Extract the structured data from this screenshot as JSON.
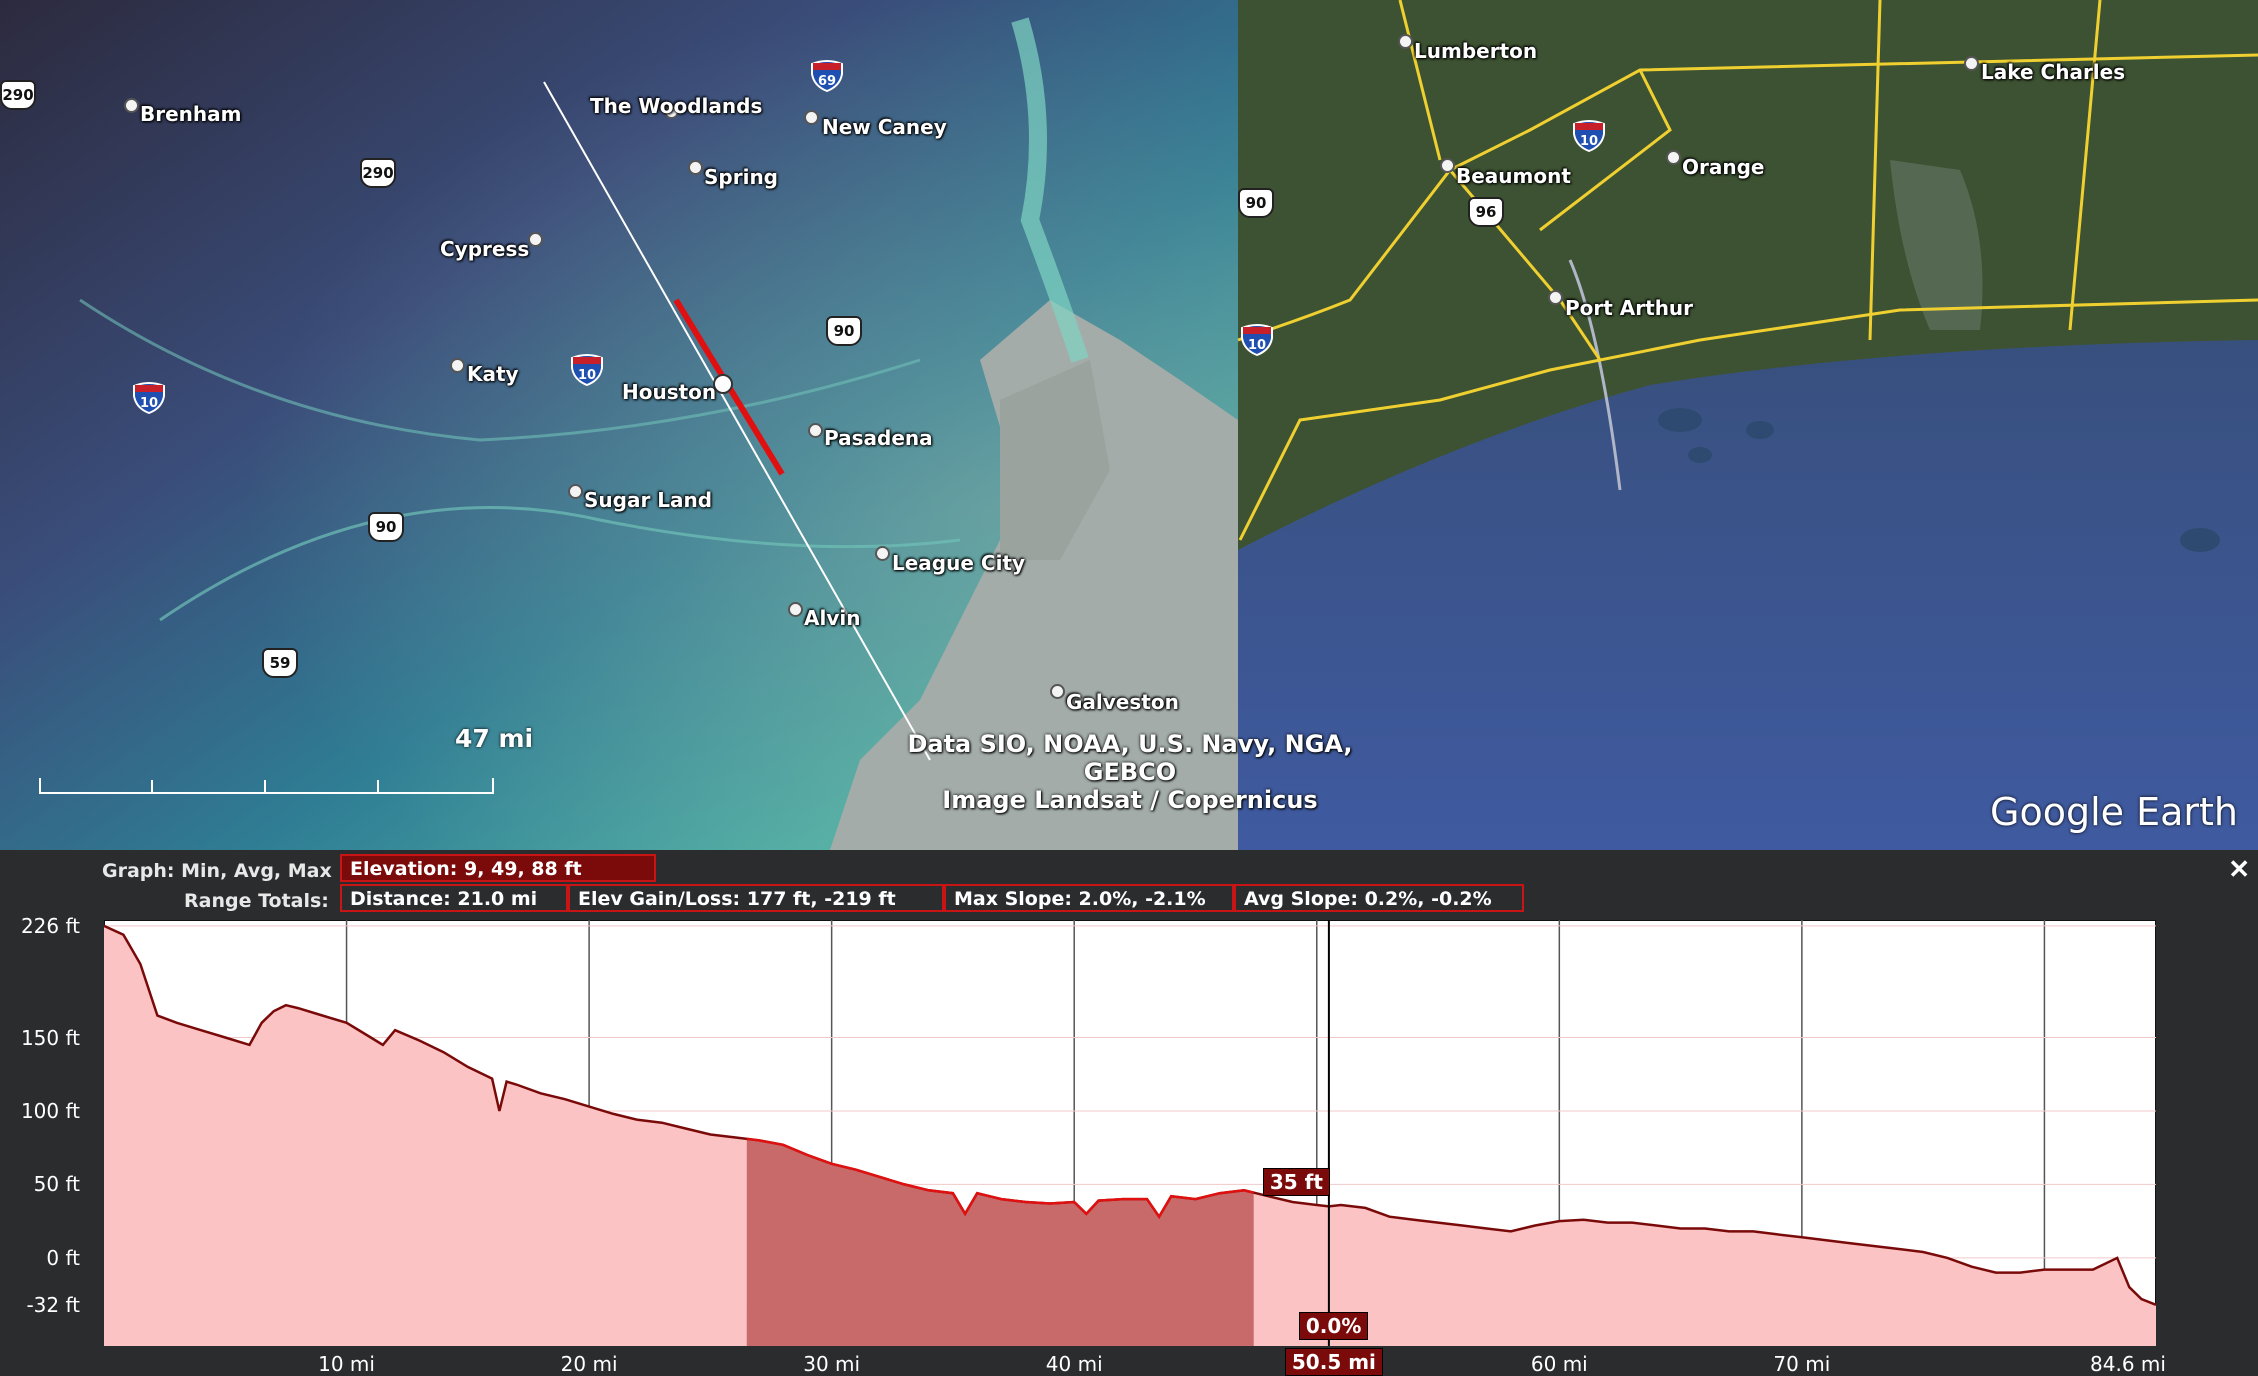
{
  "map": {
    "places": [
      {
        "name": "Brenham"
      },
      {
        "name": "The Woodlands"
      },
      {
        "name": "New Caney"
      },
      {
        "name": "Spring"
      },
      {
        "name": "Cypress"
      },
      {
        "name": "Katy"
      },
      {
        "name": "Houston"
      },
      {
        "name": "Pasadena"
      },
      {
        "name": "Sugar Land"
      },
      {
        "name": "League City"
      },
      {
        "name": "Alvin"
      },
      {
        "name": "Galveston"
      },
      {
        "name": "Lumberton"
      },
      {
        "name": "Beaumont"
      },
      {
        "name": "Orange"
      },
      {
        "name": "Port Arthur"
      },
      {
        "name": "Lake Charles"
      }
    ],
    "interstate_shields": [
      "69",
      "10",
      "10",
      "10",
      "10"
    ],
    "us_shields": [
      "290",
      "290",
      "90",
      "90",
      "59",
      "90",
      "96"
    ],
    "scale_label": "47 mi",
    "attribution_line1": "Data SIO, NOAA, U.S. Navy, NGA, GEBCO",
    "attribution_line2": "Image Landsat / Copernicus",
    "logo": "Google Earth",
    "colors": {
      "path_line": "#ffffff",
      "path_selected": "#e01010"
    }
  },
  "panel": {
    "graph_label": "Graph: Min, Avg, Max",
    "elevation": "Elevation: 9, 49, 88 ft",
    "range_label": "Range Totals:",
    "distance": "Distance: 21.0 mi",
    "elev_gain_loss": "Elev Gain/Loss: 177 ft, -219 ft",
    "max_slope": "Max Slope: 2.0%, -2.1%",
    "avg_slope": "Avg Slope: 0.2%, -0.2%",
    "close_label": "✕",
    "cursor_elev": "35 ft",
    "cursor_slope": "0.0%",
    "cursor_dist": "50.5 mi"
  },
  "chart_data": {
    "type": "area",
    "xlabel": "",
    "ylabel": "",
    "ylim": [
      -60,
      230
    ],
    "xlim": [
      0,
      84.6
    ],
    "y_ticks": [
      "226 ft",
      "150 ft",
      "100 ft",
      "50 ft",
      "0 ft",
      "-32 ft"
    ],
    "x_ticks": [
      "10 mi",
      "20 mi",
      "30 mi",
      "40 mi",
      "60 mi",
      "70 mi",
      "84.6 mi"
    ],
    "selection_range_mi": [
      26.5,
      47.4
    ],
    "cursor_mi": 50.5,
    "x": [
      0,
      0.8,
      1.5,
      2.2,
      3,
      4,
      5,
      6,
      6.5,
      7,
      7.5,
      8,
      9,
      10,
      11,
      11.5,
      12,
      13,
      14,
      15,
      16,
      16.3,
      16.6,
      17,
      18,
      19,
      20,
      21,
      22,
      23,
      24,
      25,
      26,
      27,
      28,
      29,
      30,
      31,
      32,
      33,
      34,
      35,
      35.5,
      36,
      36.5,
      37,
      38,
      39,
      40,
      40.5,
      41,
      42,
      43,
      43.5,
      44,
      45,
      46,
      47,
      48,
      49,
      50,
      50.5,
      51,
      52,
      53,
      54,
      55,
      56,
      57,
      58,
      59,
      60,
      61,
      62,
      63,
      64,
      65,
      66,
      67,
      68,
      69,
      70,
      71,
      72,
      73,
      74,
      75,
      76,
      77,
      78,
      79,
      80,
      81,
      82,
      82.5,
      83,
      83.5,
      84,
      84.6
    ],
    "values": [
      226,
      220,
      200,
      165,
      160,
      155,
      150,
      145,
      160,
      168,
      172,
      170,
      165,
      160,
      150,
      145,
      155,
      148,
      140,
      130,
      122,
      100,
      120,
      118,
      112,
      108,
      103,
      98,
      94,
      92,
      88,
      84,
      82,
      80,
      77,
      70,
      64,
      60,
      55,
      50,
      46,
      44,
      30,
      44,
      42,
      40,
      38,
      37,
      38,
      30,
      39,
      40,
      40,
      28,
      42,
      40,
      44,
      46,
      42,
      38,
      36,
      35,
      36,
      34,
      28,
      26,
      24,
      22,
      20,
      18,
      22,
      25,
      26,
      24,
      24,
      22,
      20,
      20,
      18,
      18,
      16,
      14,
      12,
      10,
      8,
      6,
      4,
      0,
      -6,
      -10,
      -10,
      -8,
      -8,
      -8,
      -4,
      0,
      -20,
      -28,
      -32
    ]
  }
}
